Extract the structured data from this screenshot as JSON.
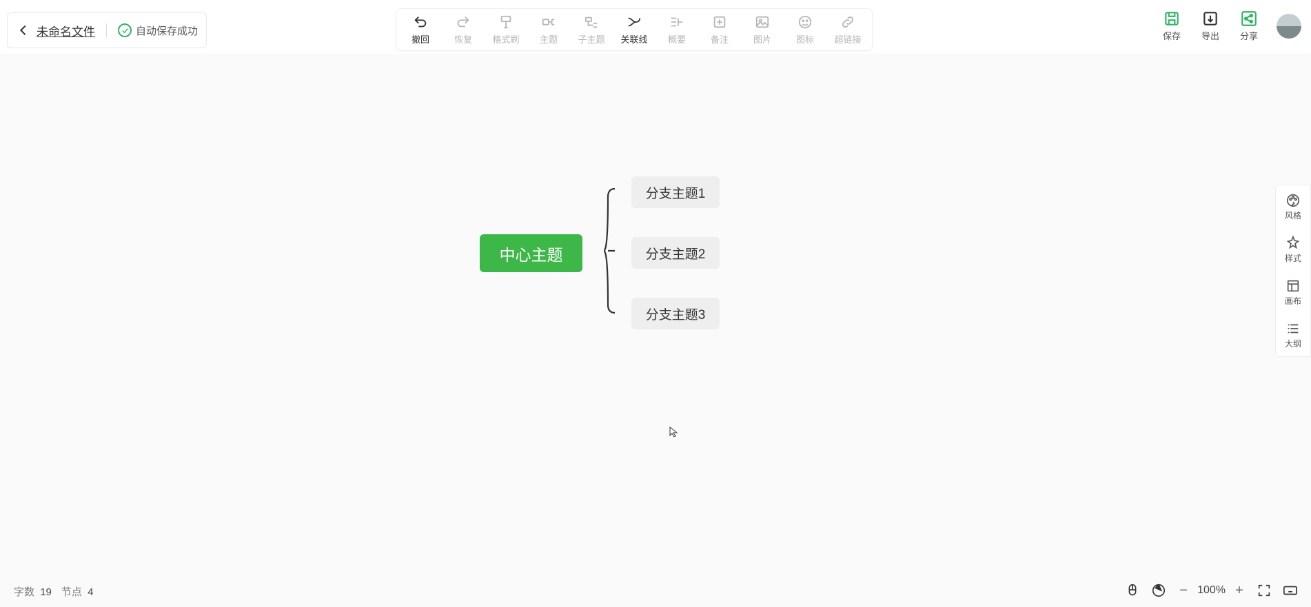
{
  "header": {
    "filename": "未命名文件",
    "save_status": "自动保存成功"
  },
  "toolbar": {
    "items": [
      {
        "id": "undo",
        "label": "撤回",
        "active": true
      },
      {
        "id": "redo",
        "label": "恢复",
        "active": false
      },
      {
        "id": "format",
        "label": "格式刷",
        "active": false
      },
      {
        "id": "topic",
        "label": "主题",
        "active": false
      },
      {
        "id": "subtopic",
        "label": "子主题",
        "active": false
      },
      {
        "id": "relation",
        "label": "关联线",
        "active": true
      },
      {
        "id": "summary",
        "label": "概要",
        "active": false
      },
      {
        "id": "note",
        "label": "备注",
        "active": false
      },
      {
        "id": "image",
        "label": "图片",
        "active": false
      },
      {
        "id": "icon",
        "label": "图标",
        "active": false
      },
      {
        "id": "hyperlink",
        "label": "超链接",
        "active": false
      }
    ]
  },
  "actions": {
    "save": "保存",
    "export": "导出",
    "share": "分享"
  },
  "mindmap": {
    "central": "中心主题",
    "branches": [
      "分支主题1",
      "分支主题2",
      "分支主题3"
    ]
  },
  "sidebar": {
    "items": [
      {
        "id": "style",
        "label": "风格"
      },
      {
        "id": "format",
        "label": "样式"
      },
      {
        "id": "canvas",
        "label": "画布"
      },
      {
        "id": "outline",
        "label": "大纲"
      }
    ]
  },
  "footer": {
    "word_label": "字数",
    "word_count": "19",
    "node_label": "节点",
    "node_count": "4",
    "zoom_level": "100%"
  },
  "colors": {
    "accent": "#3cb748"
  }
}
